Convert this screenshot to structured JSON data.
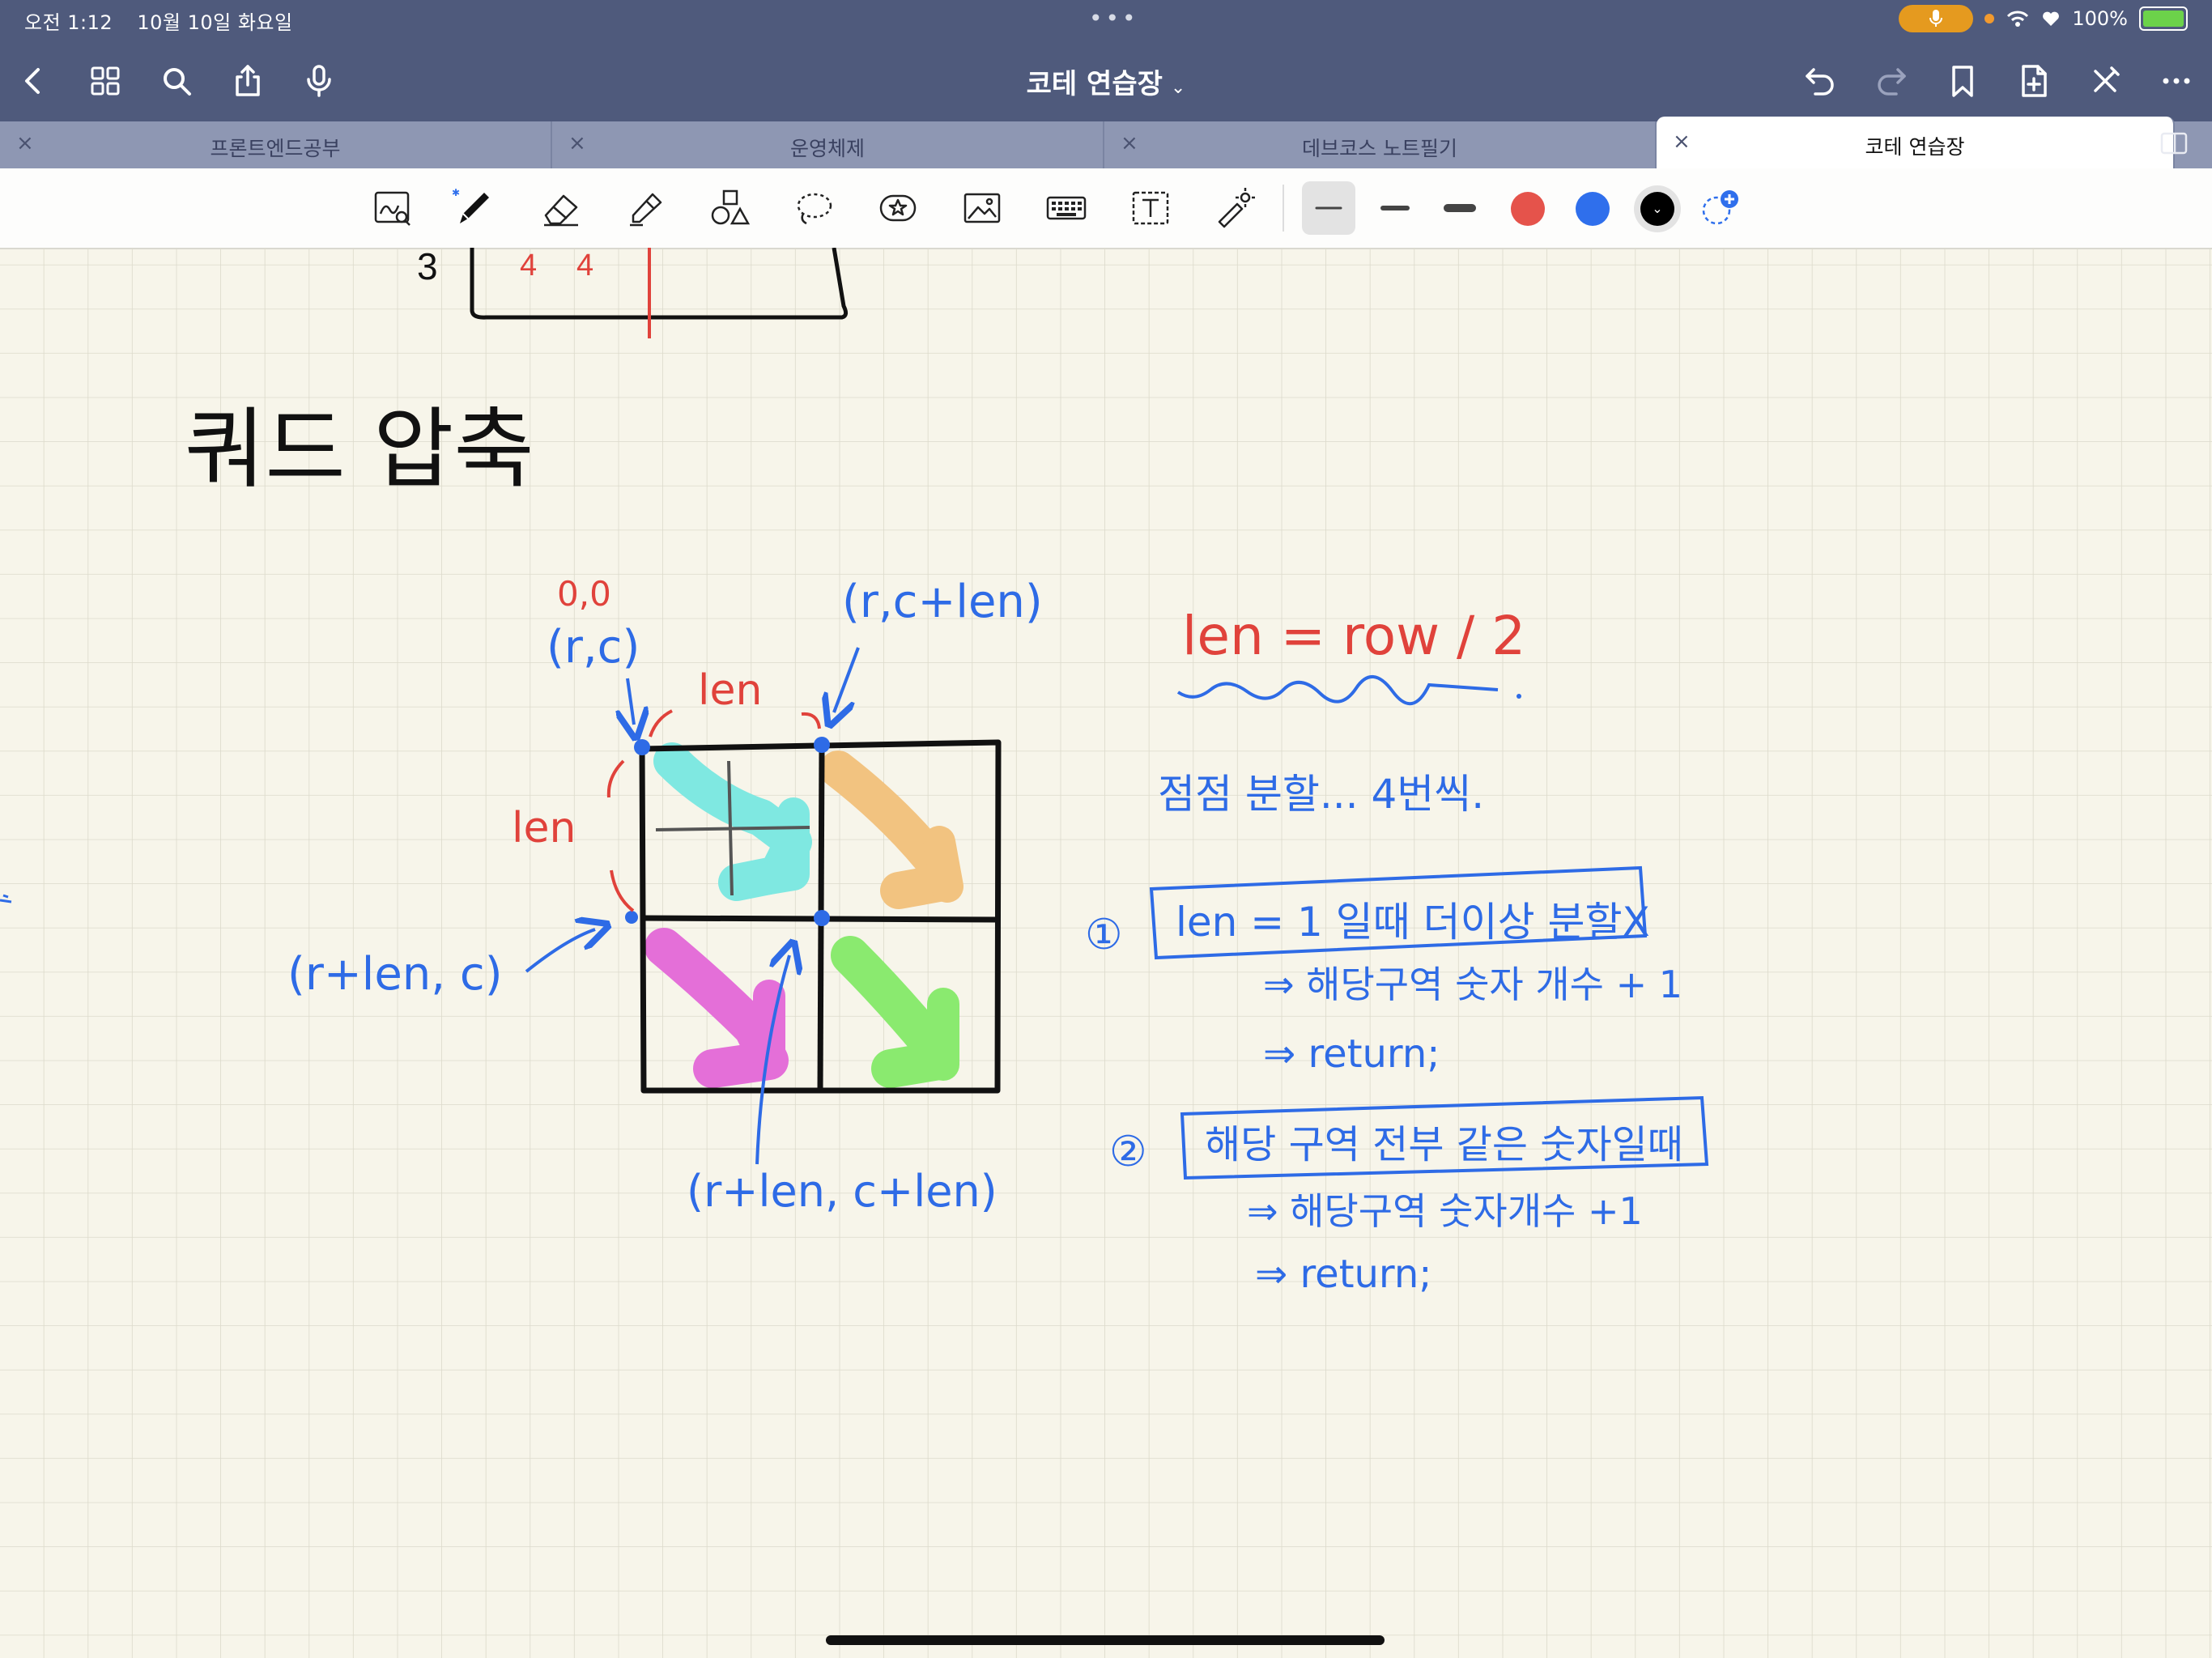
{
  "status": {
    "time": "오전 1:12",
    "date": "10월 10일 화요일",
    "battery": "100%",
    "battery_level": 1.0
  },
  "nav": {
    "title": "코테 연습장",
    "icons": [
      "back-icon",
      "grid-icon",
      "search-icon",
      "share-icon",
      "mic-icon",
      "undo-icon",
      "redo-icon",
      "bookmark-icon",
      "add-page-icon",
      "close-icon",
      "more-icon"
    ]
  },
  "tabs": [
    {
      "label": "프론트엔드공부",
      "active": false
    },
    {
      "label": "운영체제",
      "active": false
    },
    {
      "label": "데브코스 노트필기",
      "active": false
    },
    {
      "label": "코테 연습장",
      "active": true
    }
  ],
  "toolbar": {
    "tools": [
      "zoom-window-icon",
      "pen-icon",
      "eraser-icon",
      "highlighter-icon",
      "shapes-icon",
      "lasso-icon",
      "sticker-icon",
      "image-icon",
      "keyboard-icon",
      "text-icon",
      "laser-pointer-icon"
    ],
    "stroke_widths": [
      "thin",
      "medium",
      "thick"
    ],
    "colors": [
      "#e5534b",
      "#2f6fec",
      "#000000"
    ],
    "selected_color": "#000000"
  },
  "canvas": {
    "heading": "쿼드 압축",
    "label_origin": "0,0",
    "label_rc": "(r,c)",
    "label_rclen": "(r,c+len)",
    "label_len_top": "len",
    "label_len_left": "len",
    "label_rlenc": "(r+len, c)",
    "label_rlenclen": "(r+len, c+len)",
    "formula": "len = row / 2",
    "split_note": "점점 분할... 4번씩.",
    "num1": "①",
    "rule1": "len = 1 일때 더이상 분할X",
    "rule1_a": "⇒ 해당구역 숫자 개수 + 1",
    "rule1_b": "⇒ return;",
    "num2": "②",
    "rule2": "해당 구역 전부 같은 숫자일때",
    "rule2_a": "⇒ 해당구역 숫자개수 +1",
    "rule2_b": "⇒ return;",
    "prev_table_a": "4",
    "prev_table_b": "4",
    "prev_table_c": "3"
  },
  "colors": {
    "ink_blue": "#2e6be6",
    "ink_red": "#e0423b",
    "ink_black": "#111111",
    "cyan": "#7fe8e1",
    "orange": "#f2c380",
    "magenta": "#e46fd8",
    "green": "#8aea6f",
    "grid": "#d8d6c7",
    "paper": "#f7f5ea"
  }
}
